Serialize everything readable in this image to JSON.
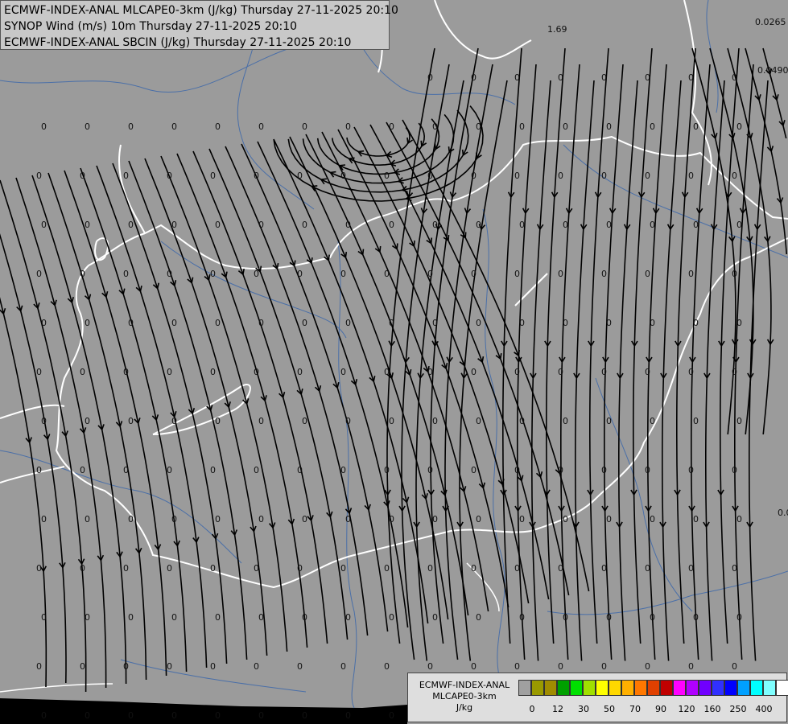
{
  "titles": [
    "ECMWF-INDEX-ANAL MLCAPE0-3km (J/kg) Thursday 27-11-2025 20:10",
    "SYNOP Wind (m/s) 10m Thursday 27-11-2025 20:10",
    "ECMWF-INDEX-ANAL SBCIN (J/kg) Thursday 27-11-2025 20:10"
  ],
  "legend": {
    "line1": "ECMWF-INDEX-ANAL",
    "line2": "MLCAPE0-3km",
    "unit": "J/kg",
    "swatch_colors": [
      "#a0a0a0",
      "#9a9a00",
      "#a08c00",
      "#00a000",
      "#00e000",
      "#a0e000",
      "#ffff00",
      "#ffd800",
      "#ffb000",
      "#ff7800",
      "#e04000",
      "#c00000",
      "#ff00ff",
      "#b000ff",
      "#7000ff",
      "#3030ff",
      "#0000ff",
      "#00a0ff",
      "#00ffff",
      "#80ffff",
      "#ffffff"
    ],
    "ticks": [
      "0",
      "12",
      "30",
      "50",
      "70",
      "90",
      "120",
      "160",
      "250",
      "400"
    ]
  },
  "labels": {
    "special": [
      "1.69",
      "0.0265",
      "0.0490",
      "0.0"
    ],
    "zero": "0"
  },
  "colors": {
    "background": "#9b9b9b",
    "streamline": "#000000",
    "border": "#ffffff",
    "river": "#4a6fa8"
  }
}
